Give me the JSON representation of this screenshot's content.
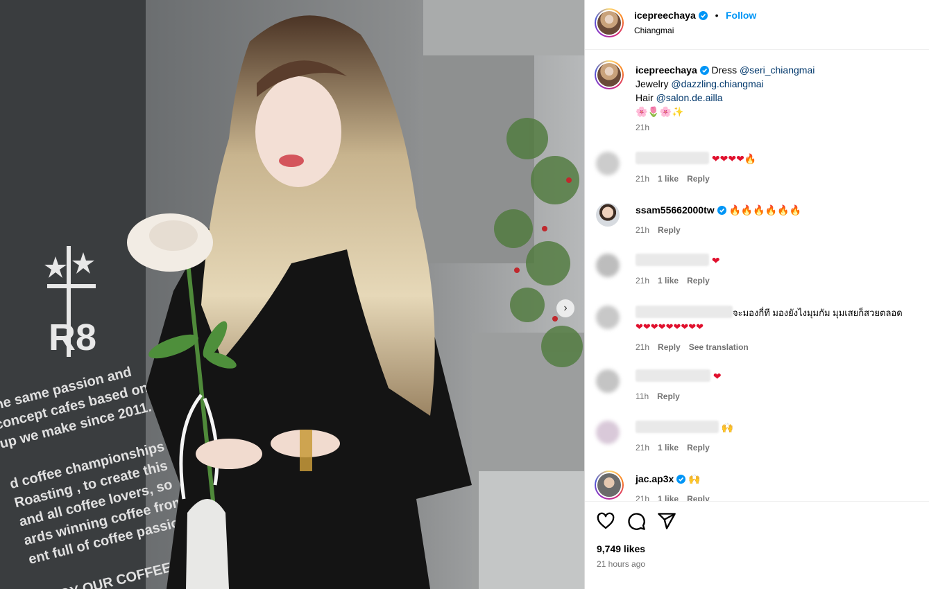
{
  "header": {
    "username": "icepreechaya",
    "follow_label": "Follow",
    "separator": "•",
    "location": "Chiangmai"
  },
  "caption": {
    "username": "icepreechaya",
    "line1_prefix": "Dress",
    "line1_mention": "@seri_chiangmai",
    "line2_prefix": "Jewelry",
    "line2_mention": "@dazzling.chiangmai",
    "line3_prefix": "Hair",
    "line3_mention": "@salon.de.ailla",
    "emojis": "🌸🌷🌸✨",
    "time": "21h"
  },
  "comments": [
    {
      "username": "",
      "text": "❤❤❤❤🔥",
      "time": "21h",
      "likes": "1 like",
      "reply": "Reply"
    },
    {
      "username": "ssam55662000tw",
      "text": "🔥🔥🔥🔥🔥🔥",
      "time": "21h",
      "reply": "Reply"
    },
    {
      "username": "",
      "text": "❤",
      "time": "21h",
      "likes": "1 like",
      "reply": "Reply"
    },
    {
      "username": "",
      "text": "จะมองกี่ที มองยังไงมุมกัม มุมเสยก็สวยตลอด",
      "text2": "❤❤❤❤❤❤❤❤❤",
      "time": "21h",
      "reply": "Reply",
      "translate": "See translation"
    },
    {
      "username": "",
      "text": "❤",
      "time": "11h",
      "reply": "Reply"
    },
    {
      "username": "",
      "text": "🙌",
      "time": "21h",
      "likes": "1 like",
      "reply": "Reply"
    },
    {
      "username": "jac.ap3x",
      "text": "🙌",
      "time": "21h",
      "likes": "1 like",
      "reply": "Reply"
    }
  ],
  "footer": {
    "likes": "9,749 likes",
    "time_ago": "21 hours ago"
  },
  "photo": {
    "signage_logo": "R8",
    "signage_text": [
      "the same passion and",
      "concept cafes based on",
      "up we make since 2011.",
      "d coffee championships",
      "Roasting , to create this",
      "and all coffee lovers, so",
      "ards winning coffee from",
      "ent full of coffee passion.",
      "JOY OUR COFFEE"
    ]
  },
  "colors": {
    "accent": "#0095f6",
    "verified": "#0095f6",
    "mention": "#00376b",
    "muted": "#737373"
  }
}
